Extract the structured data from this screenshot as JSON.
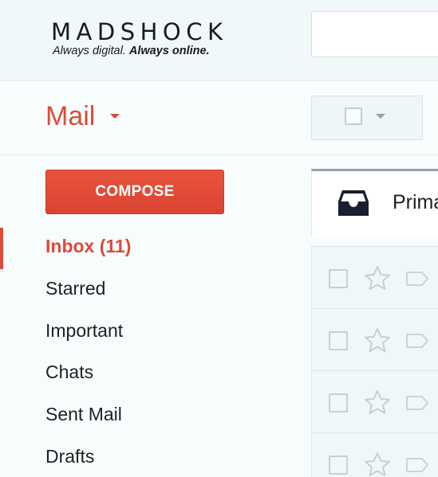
{
  "brand": {
    "name": "MADSHOCK",
    "tagline_regular": "Always digital.",
    "tagline_bold": "Always online."
  },
  "search": {
    "value": ""
  },
  "toolbar": {
    "mail_label": "Mail"
  },
  "compose": {
    "label": "COMPOSE"
  },
  "nav": {
    "items": [
      {
        "label": "Inbox (11)",
        "active": true
      },
      {
        "label": "Starred"
      },
      {
        "label": "Important"
      },
      {
        "label": "Chats"
      },
      {
        "label": "Sent Mail"
      },
      {
        "label": "Drafts"
      }
    ]
  },
  "tabs": {
    "primary_label": "Prima"
  },
  "icons": {
    "inbox": "inbox-tray-icon",
    "star": "star-outline-icon",
    "label": "label-tag-icon",
    "caret": "caret-down-icon"
  },
  "colors": {
    "accent": "#dd4b39",
    "compose_bg": "#e14d3a",
    "header_bg": "#f1f8fa",
    "list_bg": "#eef8fa"
  },
  "rows": [
    {},
    {},
    {},
    {}
  ]
}
